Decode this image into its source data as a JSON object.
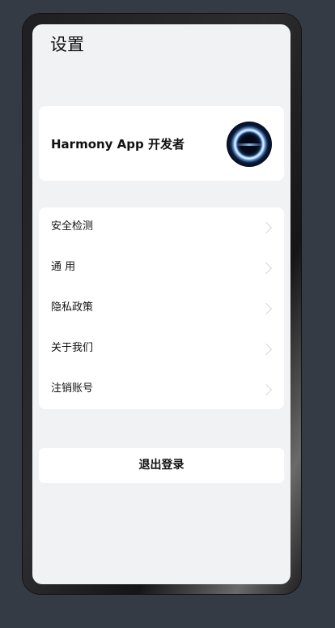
{
  "page": {
    "title": "设置"
  },
  "profile": {
    "name": "Harmony App 开发者",
    "avatar_icon": "glowing-ring-avatar"
  },
  "menu": {
    "items": [
      {
        "label": "安全检测",
        "icon": "chevron-right-icon"
      },
      {
        "label": "通 用",
        "icon": "chevron-right-icon"
      },
      {
        "label": "隐私政策",
        "icon": "chevron-right-icon"
      },
      {
        "label": "关于我们",
        "icon": "chevron-right-icon"
      },
      {
        "label": "注销账号",
        "icon": "chevron-right-icon"
      }
    ]
  },
  "actions": {
    "logout_label": "退出登录"
  },
  "colors": {
    "page_background": "#f1f2f3",
    "card_background": "#ffffff",
    "outer_background": "#353b45",
    "text_primary": "#111111",
    "chevron": "#d6d6d6"
  }
}
